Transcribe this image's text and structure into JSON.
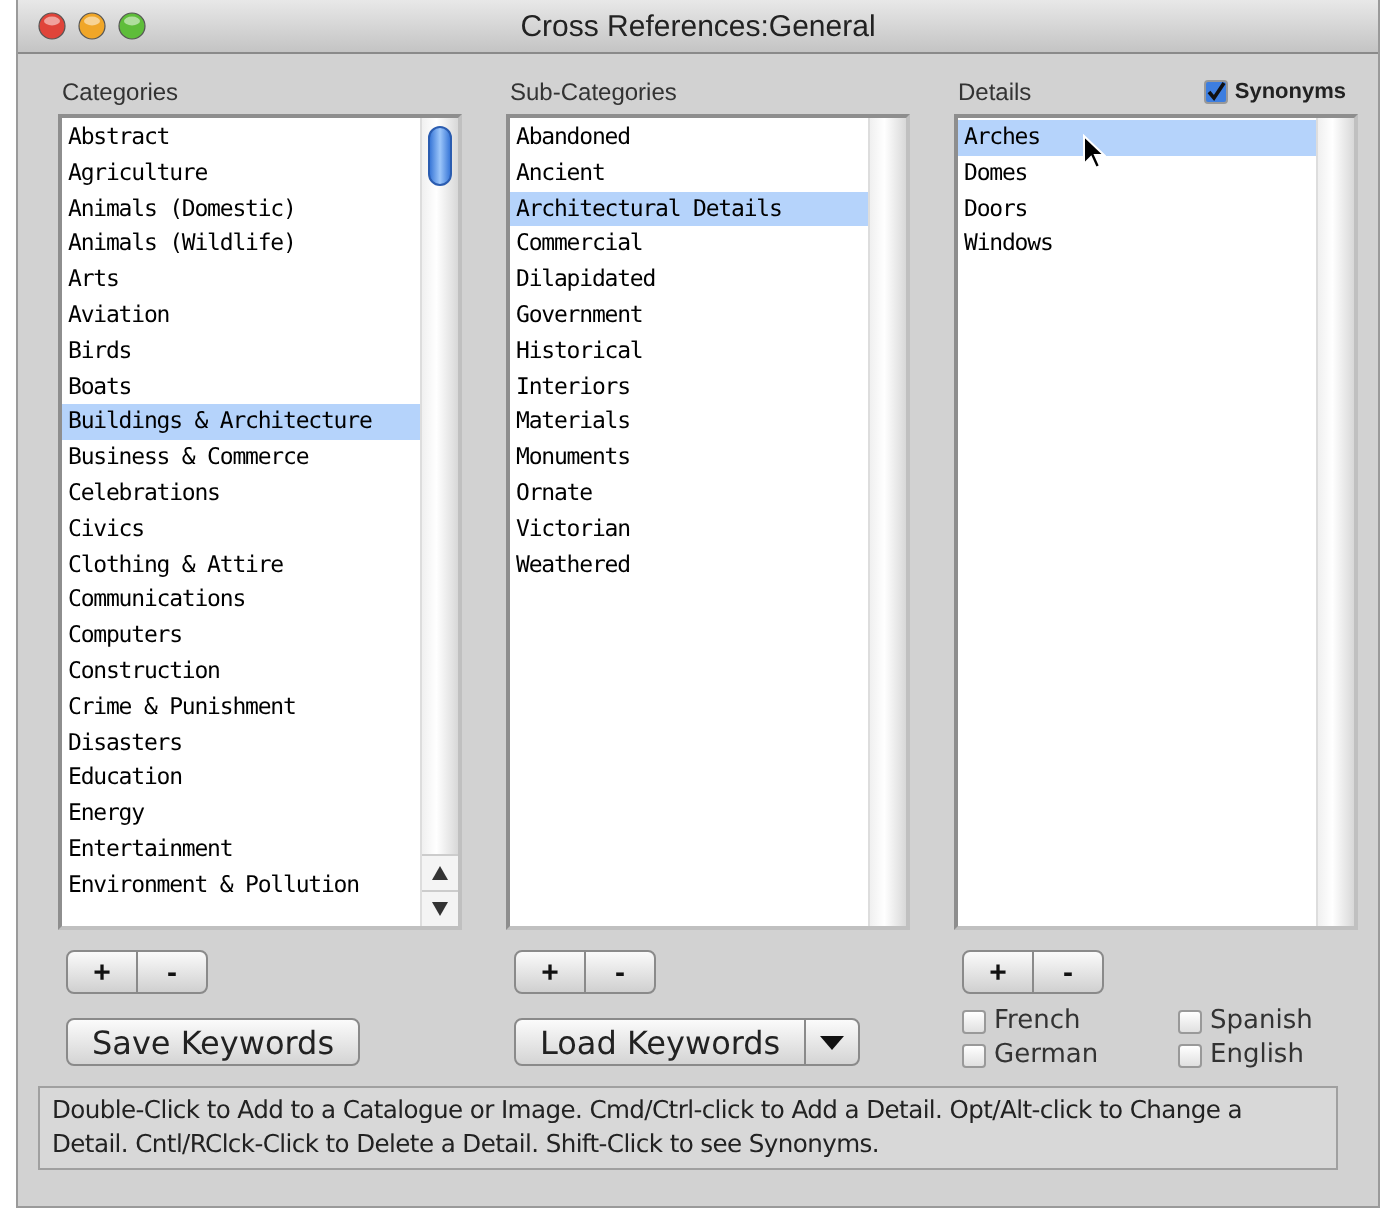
{
  "window": {
    "title": "Cross References:General"
  },
  "categories": {
    "label": "Categories",
    "items": [
      {
        "label": "Abstract",
        "selected": false
      },
      {
        "label": "Agriculture",
        "selected": false
      },
      {
        "label": "Animals (Domestic)",
        "selected": false
      },
      {
        "label": "Animals (Wildlife)",
        "selected": false
      },
      {
        "label": "Arts",
        "selected": false
      },
      {
        "label": "Aviation",
        "selected": false
      },
      {
        "label": "Birds",
        "selected": false
      },
      {
        "label": "Boats",
        "selected": false
      },
      {
        "label": "Buildings & Architecture",
        "selected": true
      },
      {
        "label": "Business & Commerce",
        "selected": false
      },
      {
        "label": "Celebrations",
        "selected": false
      },
      {
        "label": "Civics",
        "selected": false
      },
      {
        "label": "Clothing & Attire",
        "selected": false
      },
      {
        "label": "Communications",
        "selected": false
      },
      {
        "label": "Computers",
        "selected": false
      },
      {
        "label": "Construction",
        "selected": false
      },
      {
        "label": "Crime & Punishment",
        "selected": false
      },
      {
        "label": "Disasters",
        "selected": false
      },
      {
        "label": "Education",
        "selected": false
      },
      {
        "label": "Energy",
        "selected": false
      },
      {
        "label": "Entertainment",
        "selected": false
      },
      {
        "label": "Environment & Pollution",
        "selected": false
      }
    ],
    "add": "+",
    "remove": "-"
  },
  "sub_categories": {
    "label": "Sub-Categories",
    "items": [
      {
        "label": "Abandoned",
        "selected": false
      },
      {
        "label": "Ancient",
        "selected": false
      },
      {
        "label": "Architectural Details",
        "selected": true
      },
      {
        "label": "Commercial",
        "selected": false
      },
      {
        "label": "Dilapidated",
        "selected": false
      },
      {
        "label": "Government",
        "selected": false
      },
      {
        "label": "Historical",
        "selected": false
      },
      {
        "label": "Interiors",
        "selected": false
      },
      {
        "label": "Materials",
        "selected": false
      },
      {
        "label": "Monuments",
        "selected": false
      },
      {
        "label": "Ornate",
        "selected": false
      },
      {
        "label": "Victorian",
        "selected": false
      },
      {
        "label": "Weathered",
        "selected": false
      }
    ],
    "add": "+",
    "remove": "-"
  },
  "details": {
    "label": "Details",
    "synonyms": {
      "label": "Synonyms",
      "checked": true
    },
    "items": [
      {
        "label": "Arches",
        "selected": true
      },
      {
        "label": "Domes",
        "selected": false
      },
      {
        "label": "Doors",
        "selected": false
      },
      {
        "label": "Windows",
        "selected": false
      }
    ],
    "add": "+",
    "remove": "-"
  },
  "save_button": "Save Keywords",
  "load_button": "Load Keywords",
  "languages": [
    {
      "label": "French",
      "checked": false
    },
    {
      "label": "Spanish",
      "checked": false
    },
    {
      "label": "German",
      "checked": false
    },
    {
      "label": "English",
      "checked": false
    }
  ],
  "help_text": "Double-Click to Add to a Catalogue or Image. Cmd/Ctrl-click to Add a Detail. Opt/Alt-click to Change a Detail. Cntl/RClck-Click to Delete a Detail. Shift-Click to see Synonyms."
}
